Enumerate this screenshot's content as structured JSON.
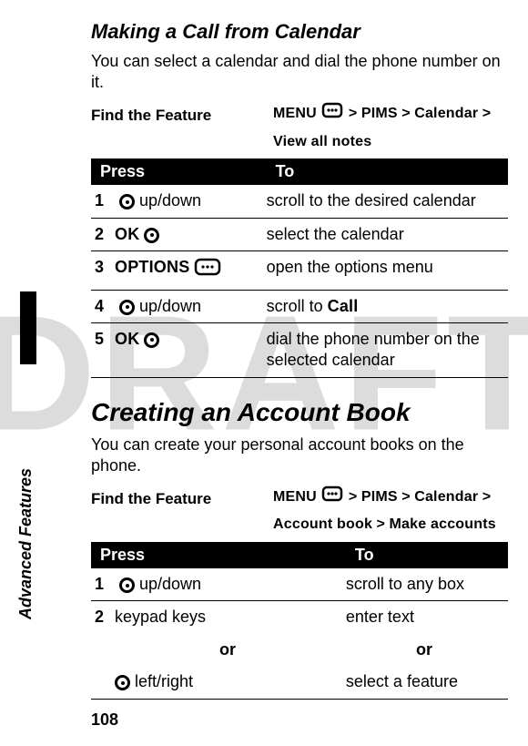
{
  "watermark": "DRAFT",
  "side_label": "Advanced Features",
  "page_number": "108",
  "section1": {
    "title": "Making a Call from Calendar",
    "intro": "You can select a calendar and dial the phone number on it.",
    "find_label": "Find the Feature",
    "path": {
      "p1": "MENU",
      "sep": ">",
      "p2": "PIMS",
      "p3": "Calendar",
      "p4": "View all notes"
    },
    "table": {
      "h1": "Press",
      "h2": "To",
      "rows": [
        {
          "n": "1",
          "press_suffix": " up/down",
          "to": "scroll to the desired calendar"
        },
        {
          "n": "2",
          "press_label": "OK",
          "to": "select the calendar"
        },
        {
          "n": "3",
          "press_label": "OPTIONS",
          "to": "open the options menu"
        },
        {
          "n": "4",
          "press_suffix": " up/down",
          "to_prefix": "scroll to ",
          "to_bold": "Call"
        },
        {
          "n": "5",
          "press_label": "OK",
          "to": "dial the phone number on the selected calendar"
        }
      ]
    }
  },
  "section2": {
    "title": "Creating an Account Book",
    "intro": "You can create your personal account books on the phone.",
    "find_label": "Find the Feature",
    "path": {
      "p1": "MENU",
      "sep": ">",
      "p2": "PIMS",
      "p3": "Calendar",
      "p4": "Account book",
      "p5": "Make accounts"
    },
    "table": {
      "h1": "Press",
      "h2": "To",
      "rows": [
        {
          "n": "1",
          "press_suffix": " up/down",
          "to": "scroll to any box"
        },
        {
          "n": "2",
          "press_text": "keypad keys",
          "to": "enter text"
        }
      ],
      "or": "or",
      "last": {
        "press_suffix": " left/right",
        "to": "select a feature"
      }
    }
  }
}
